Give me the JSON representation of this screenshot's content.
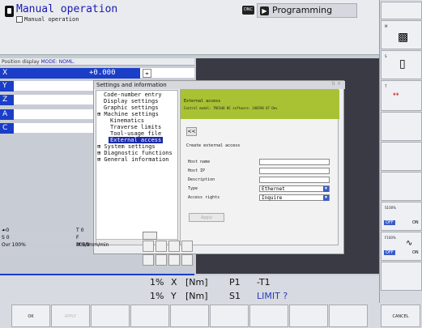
{
  "header": {
    "mode_title": "Manual operation",
    "mode_subtitle": "Manual operation",
    "dnc_badge": "DNC",
    "programming_tab": "Programming"
  },
  "position_display": {
    "label": "Position display",
    "mode_label": "MODE: NOML.",
    "axes": [
      {
        "name": "X",
        "value": "+0.000"
      },
      {
        "name": "Y"
      },
      {
        "name": "Z"
      },
      {
        "name": "A"
      },
      {
        "name": "C"
      }
    ]
  },
  "settings_window": {
    "title": "Settings and information",
    "tree": [
      {
        "label": "Code-number entry"
      },
      {
        "label": "Display settings"
      },
      {
        "label": "Graphic settings"
      },
      {
        "label": "⊞ Machine settings"
      },
      {
        "label": "Kinematics"
      },
      {
        "label": "Traverse limits"
      },
      {
        "label": "Tool-usage file"
      },
      {
        "label": "External access"
      },
      {
        "label": "⊞ System settings"
      },
      {
        "label": "⊞ Diagnostic functions"
      },
      {
        "label": "⊞ General information"
      }
    ]
  },
  "external_access": {
    "heading": "External access",
    "info_line": "Control model: TNC640      NC software: 340590 07 Dev",
    "back_label": "<<",
    "create_label": "Create external access",
    "fields": [
      {
        "label": "Host name",
        "value": ""
      },
      {
        "label": "Host IP",
        "value": ""
      },
      {
        "label": "Description",
        "value": ""
      },
      {
        "label": "Type",
        "value": "Ethernet"
      },
      {
        "label": "Access rights",
        "value": "Inquire"
      }
    ],
    "apply_label": "Apply"
  },
  "status": {
    "rows": [
      {
        "left": "☙0",
        "right": "T 0"
      },
      {
        "left": "S 0",
        "right": "F 3000mm/min"
      },
      {
        "left": "Ovr 100%",
        "right": "M 5/9"
      }
    ],
    "line1": {
      "pct": "1%",
      "axis": "X",
      "unit": "[Nm]",
      "p": "P1",
      "t": "-T1"
    },
    "line2": {
      "pct": "1%",
      "axis": "Y",
      "unit": "[Nm]",
      "s": "S1",
      "limit": "LIMIT ?"
    }
  },
  "right_softkeys": {
    "k2": "M",
    "k3": "S",
    "k4": "T",
    "s100": "S100%",
    "f100": "F100%",
    "off": "OFF",
    "on": "ON"
  },
  "bottom_softkeys": {
    "ok": "OK",
    "apply": "APPLY",
    "cancel": "CANCEL"
  }
}
